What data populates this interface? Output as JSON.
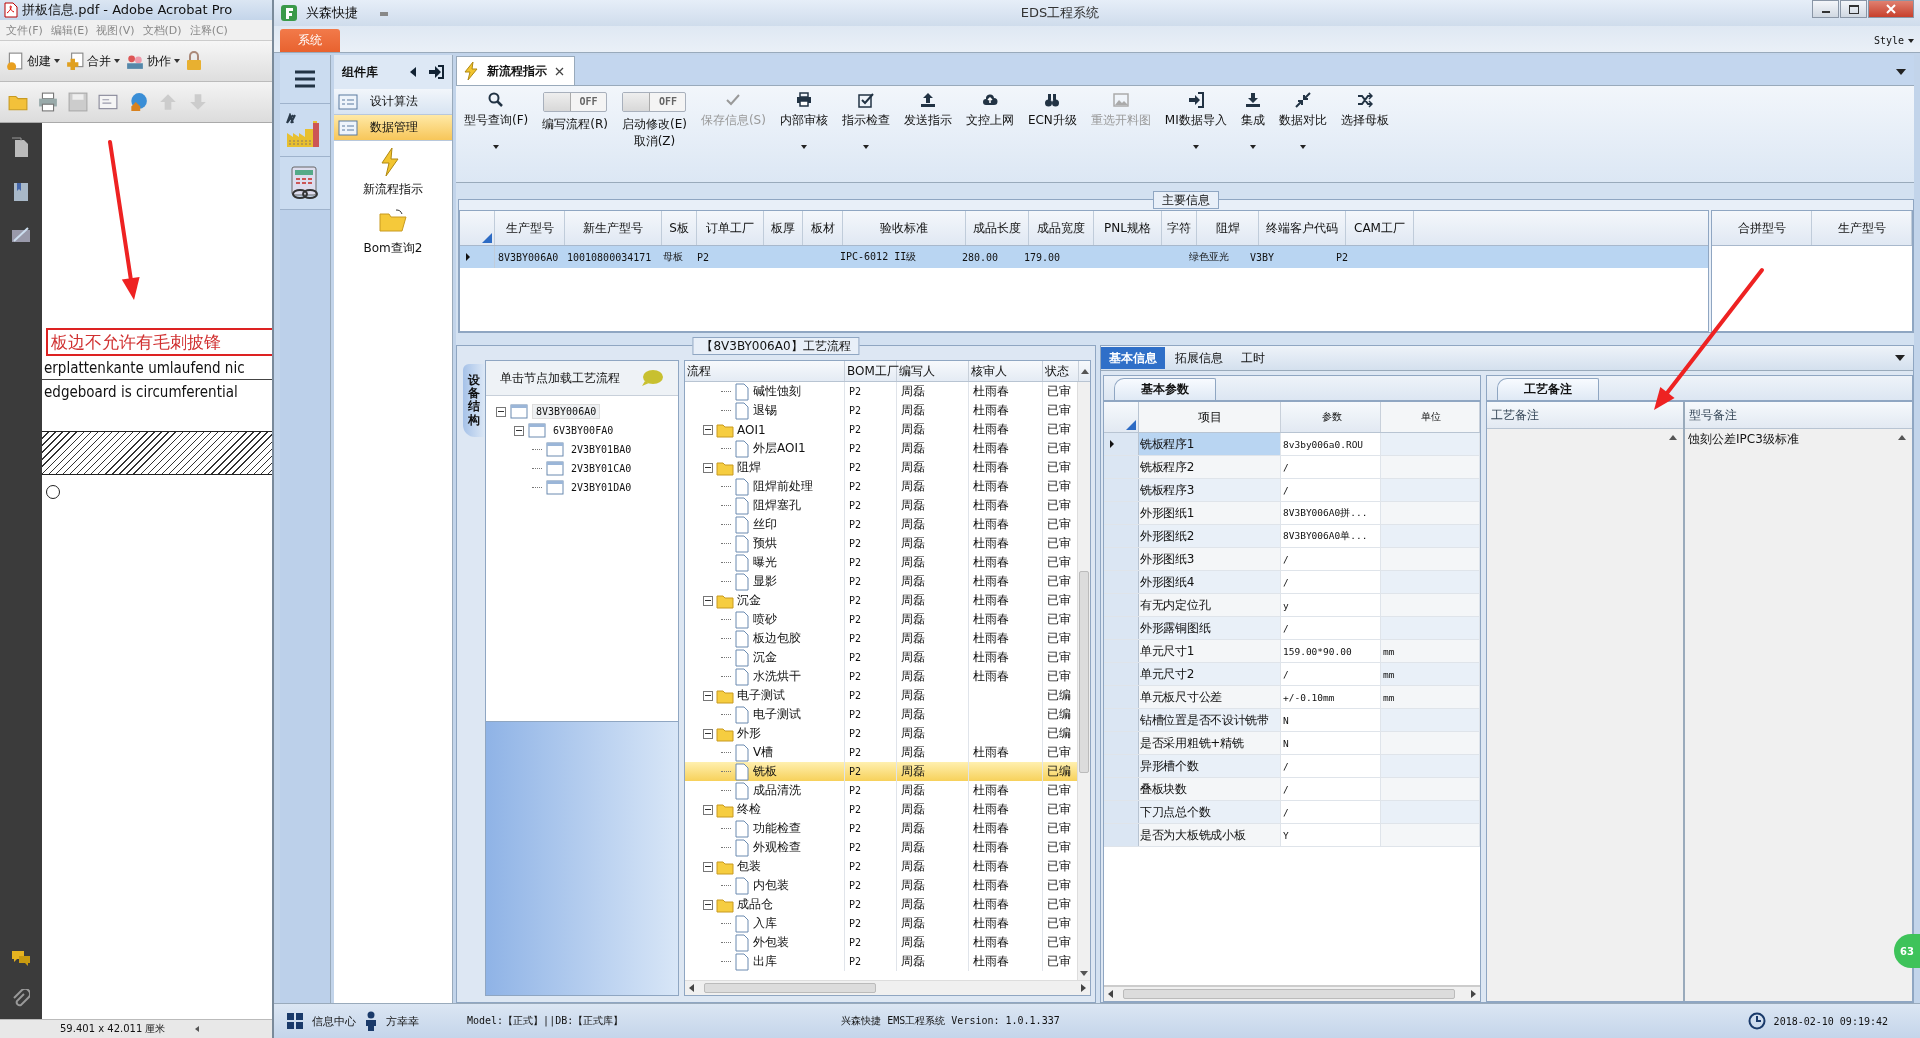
{
  "acrobat": {
    "title": "拼板信息.pdf - Adobe Acrobat Pro",
    "menu": [
      "文件(F)",
      "编辑(E)",
      "视图(V)",
      "文档(D)",
      "注释(C)"
    ],
    "tools": [
      {
        "label": "创建"
      },
      {
        "label": "合并"
      },
      {
        "label": "协作"
      }
    ],
    "document": {
      "note": "板边不允许有毛刺披锋",
      "lines": [
        "erplattenkante umlaufend nic",
        "edgeboard is circumferential"
      ]
    },
    "status": "59.401 x 42.011 厘米"
  },
  "eds": {
    "app_name": "兴森快捷",
    "title": "EDS工程系统",
    "menu_tab": "系统",
    "style_menu": "Style",
    "library": {
      "title": "组件库",
      "categories": [
        {
          "label": "设计算法",
          "selected": false
        },
        {
          "label": "数据管理",
          "selected": true
        }
      ],
      "items": [
        {
          "label": "新流程指示"
        },
        {
          "label": "Bom查询2"
        }
      ]
    },
    "doc_tab": {
      "label": "新流程指示"
    },
    "toolbar": [
      {
        "kind": "button",
        "label": "型号查询(F)",
        "disabled": false,
        "dropdown": true
      },
      {
        "kind": "toggle",
        "label": "编写流程(R)",
        "state_text": "OFF",
        "on": false
      },
      {
        "kind": "toggle",
        "label": "启动修改(E)\n取消(Z)",
        "state_text": "OFF",
        "on": false
      },
      {
        "kind": "button",
        "label": "保存信息(S)",
        "disabled": true,
        "dropdown": false
      },
      {
        "kind": "button",
        "label": "内部审核",
        "disabled": false,
        "dropdown": true
      },
      {
        "kind": "button",
        "label": "指示检查",
        "disabled": false,
        "dropdown": true
      },
      {
        "kind": "button",
        "label": "发送指示",
        "disabled": false,
        "dropdown": false
      },
      {
        "kind": "button",
        "label": "文控上网",
        "disabled": false,
        "dropdown": false
      },
      {
        "kind": "button",
        "label": "ECN升级",
        "disabled": false,
        "dropdown": false
      },
      {
        "kind": "button",
        "label": "重选开料图",
        "disabled": true,
        "dropdown": false
      },
      {
        "kind": "button",
        "label": "MI数据导入",
        "disabled": false,
        "dropdown": true
      },
      {
        "kind": "button",
        "label": "集成",
        "disabled": false,
        "dropdown": true
      },
      {
        "kind": "button",
        "label": "数据对比",
        "disabled": false,
        "dropdown": true
      },
      {
        "kind": "button",
        "label": "选择母板",
        "disabled": false,
        "dropdown": false
      }
    ],
    "main_info": {
      "title": "主要信息",
      "columns": [
        "生产型号",
        "新生产型号",
        "S板",
        "订单工厂",
        "板厚",
        "板材",
        "验收标准",
        "成品长度",
        "成品宽度",
        "PNL规格",
        "字符",
        "阻焊",
        "终端客户代码",
        "CAM工厂"
      ],
      "rows": [
        {
          "selected": true,
          "cells": [
            "8V3BY006A0",
            "10010800034171",
            "母板",
            "P2",
            null,
            null,
            "IPC-6012 II级",
            "280.00",
            "179.00",
            null,
            null,
            "绿色亚光",
            "V3BY",
            "P2"
          ]
        }
      ]
    },
    "merge_table": {
      "columns": [
        "合拼型号",
        "生产型号"
      ]
    },
    "flow": {
      "title": "【8V3BY006A0】工艺流程",
      "side_tab": "设备结构",
      "tree_hint": "单击节点加载工艺流程",
      "tree": [
        {
          "label": "8V3BY006A0",
          "selected": true,
          "expanded": true,
          "children": [
            {
              "label": "6V3BY00FA0",
              "selected": false,
              "expanded": true,
              "children": [
                {
                  "label": "2V3BY01BA0",
                  "selected": false
                },
                {
                  "label": "2V3BY01CA0",
                  "selected": false
                },
                {
                  "label": "2V3BY01DA0",
                  "selected": false
                }
              ]
            }
          ]
        }
      ],
      "columns": [
        "流程",
        "BOM工厂",
        "编写人",
        "核审人",
        "状态"
      ],
      "rows": [
        {
          "kind": "step",
          "name": "碱性蚀刻",
          "bom": "P2",
          "writer": "周磊",
          "reviewer": "杜雨春",
          "status": "已审",
          "selected": false
        },
        {
          "kind": "step",
          "name": "退锡",
          "bom": "P2",
          "writer": "周磊",
          "reviewer": "杜雨春",
          "status": "已审",
          "selected": false
        },
        {
          "kind": "folder",
          "name": "AOI1",
          "bom": "P2",
          "writer": "周磊",
          "reviewer": "杜雨春",
          "status": "已审",
          "selected": false,
          "expanded": true,
          "children": [
            {
              "kind": "step",
              "name": "外层AOI1",
              "bom": "P2",
              "writer": "周磊",
              "reviewer": "杜雨春",
              "status": "已审",
              "selected": false
            }
          ]
        },
        {
          "kind": "folder",
          "name": "阻焊",
          "bom": "P2",
          "writer": "周磊",
          "reviewer": "杜雨春",
          "status": "已审",
          "selected": false,
          "expanded": true,
          "children": [
            {
              "kind": "step",
              "name": "阻焊前处理",
              "bom": "P2",
              "writer": "周磊",
              "reviewer": "杜雨春",
              "status": "已审",
              "selected": false
            },
            {
              "kind": "step",
              "name": "阻焊塞孔",
              "bom": "P2",
              "writer": "周磊",
              "reviewer": "杜雨春",
              "status": "已审",
              "selected": false
            },
            {
              "kind": "step",
              "name": "丝印",
              "bom": "P2",
              "writer": "周磊",
              "reviewer": "杜雨春",
              "status": "已审",
              "selected": false
            },
            {
              "kind": "step",
              "name": "预烘",
              "bom": "P2",
              "writer": "周磊",
              "reviewer": "杜雨春",
              "status": "已审",
              "selected": false
            },
            {
              "kind": "step",
              "name": "曝光",
              "bom": "P2",
              "writer": "周磊",
              "reviewer": "杜雨春",
              "status": "已审",
              "selected": false
            },
            {
              "kind": "step",
              "name": "显影",
              "bom": "P2",
              "writer": "周磊",
              "reviewer": "杜雨春",
              "status": "已审",
              "selected": false
            }
          ]
        },
        {
          "kind": "folder",
          "name": "沉金",
          "bom": "P2",
          "writer": "周磊",
          "reviewer": "杜雨春",
          "status": "已审",
          "selected": false,
          "expanded": true,
          "children": [
            {
              "kind": "step",
              "name": "喷砂",
              "bom": "P2",
              "writer": "周磊",
              "reviewer": "杜雨春",
              "status": "已审",
              "selected": false
            },
            {
              "kind": "step",
              "name": "板边包胶",
              "bom": "P2",
              "writer": "周磊",
              "reviewer": "杜雨春",
              "status": "已审",
              "selected": false
            },
            {
              "kind": "step",
              "name": "沉金",
              "bom": "P2",
              "writer": "周磊",
              "reviewer": "杜雨春",
              "status": "已审",
              "selected": false
            },
            {
              "kind": "step",
              "name": "水洗烘干",
              "bom": "P2",
              "writer": "周磊",
              "reviewer": "杜雨春",
              "status": "已审",
              "selected": false
            }
          ]
        },
        {
          "kind": "folder",
          "name": "电子测试",
          "bom": "P2",
          "writer": "周磊",
          "status": "已编",
          "selected": false,
          "expanded": true,
          "children": [
            {
              "kind": "step",
              "name": "电子测试",
              "bom": "P2",
              "writer": "周磊",
              "status": "已编",
              "selected": false
            }
          ]
        },
        {
          "kind": "folder",
          "name": "外形",
          "bom": "P2",
          "writer": "周磊",
          "status": "已编",
          "selected": false,
          "expanded": true,
          "children": [
            {
              "kind": "step",
              "name": "V槽",
              "bom": "P2",
              "writer": "周磊",
              "reviewer": "杜雨春",
              "status": "已审",
              "selected": false
            },
            {
              "kind": "step",
              "name": "铣板",
              "bom": "P2",
              "writer": "周磊",
              "status": "已编",
              "selected": true
            },
            {
              "kind": "step",
              "name": "成品清洗",
              "bom": "P2",
              "writer": "周磊",
              "reviewer": "杜雨春",
              "status": "已审",
              "selected": false
            }
          ]
        },
        {
          "kind": "folder",
          "name": "终检",
          "bom": "P2",
          "writer": "周磊",
          "reviewer": "杜雨春",
          "status": "已审",
          "selected": false,
          "expanded": true,
          "children": [
            {
              "kind": "step",
              "name": "功能检查",
              "bom": "P2",
              "writer": "周磊",
              "reviewer": "杜雨春",
              "status": "已审",
              "selected": false
            },
            {
              "kind": "step",
              "name": "外观检查",
              "bom": "P2",
              "writer": "周磊",
              "reviewer": "杜雨春",
              "status": "已审",
              "selected": false
            }
          ]
        },
        {
          "kind": "folder",
          "name": "包装",
          "bom": "P2",
          "writer": "周磊",
          "reviewer": "杜雨春",
          "status": "已审",
          "selected": false,
          "expanded": true,
          "children": [
            {
              "kind": "step",
              "name": "内包装",
              "bom": "P2",
              "writer": "周磊",
              "reviewer": "杜雨春",
              "status": "已审",
              "selected": false
            }
          ]
        },
        {
          "kind": "folder",
          "name": "成品仓",
          "bom": "P2",
          "writer": "周磊",
          "reviewer": "杜雨春",
          "status": "已审",
          "selected": false,
          "expanded": true,
          "children": [
            {
              "kind": "step",
              "name": "入库",
              "bom": "P2",
              "writer": "周磊",
              "reviewer": "杜雨春",
              "status": "已审",
              "selected": false
            },
            {
              "kind": "step",
              "name": "外包装",
              "bom": "P2",
              "writer": "周磊",
              "reviewer": "杜雨春",
              "status": "已审",
              "selected": false
            },
            {
              "kind": "step",
              "name": "出库",
              "bom": "P2",
              "writer": "周磊",
              "reviewer": "杜雨春",
              "status": "已审",
              "selected": false
            }
          ]
        }
      ]
    },
    "detail": {
      "tabs": [
        {
          "label": "基本信息",
          "selected": true
        },
        {
          "label": "拓展信息",
          "selected": false
        },
        {
          "label": "工时",
          "selected": false
        }
      ],
      "params": {
        "tab": "基本参数",
        "columns": [
          "项目",
          "参数",
          "单位"
        ],
        "rows": [
          {
            "item": "铣板程序1",
            "value": "8v3by006a0.ROU",
            "selected": true
          },
          {
            "item": "铣板程序2",
            "value": "/",
            "selected": false
          },
          {
            "item": "铣板程序3",
            "value": "/",
            "selected": false
          },
          {
            "item": "外形图纸1",
            "value": "8V3BY006A0拼...",
            "selected": false
          },
          {
            "item": "外形图纸2",
            "value": "8V3BY006A0单...",
            "selected": false
          },
          {
            "item": "外形图纸3",
            "value": "/",
            "selected": false
          },
          {
            "item": "外形图纸4",
            "value": "/",
            "selected": false
          },
          {
            "item": "有无内定位孔",
            "value": "y",
            "selected": false
          },
          {
            "item": "外形露铜图纸",
            "value": "/",
            "selected": false
          },
          {
            "item": "单元尺寸1",
            "value": "159.00*90.00",
            "unit": "mm",
            "selected": false
          },
          {
            "item": "单元尺寸2",
            "value": "/",
            "unit": "mm",
            "selected": false
          },
          {
            "item": "单元板尺寸公差",
            "value": "+/-0.10mm",
            "unit": "mm",
            "selected": false
          },
          {
            "item": "钻槽位置是否不设计铣带",
            "value": "N",
            "selected": false
          },
          {
            "item": "是否采用粗铣+精铣",
            "value": "N",
            "selected": false
          },
          {
            "item": "异形槽个数",
            "value": "/",
            "selected": false
          },
          {
            "item": "叠板块数",
            "value": "/",
            "selected": false
          },
          {
            "item": "下刀点总个数",
            "value": "/",
            "selected": false
          },
          {
            "item": "是否为大板铣成小板",
            "value": "Y",
            "selected": false
          }
        ]
      },
      "remarks": {
        "tab": "工艺备注",
        "columns": [
          {
            "title": "工艺备注"
          },
          {
            "title": "型号备注",
            "text": "蚀刻公差IPC3级标准"
          }
        ]
      }
    },
    "badge": "63",
    "status_bar": {
      "info": "信息中心",
      "user": "方幸幸",
      "env": "Model:【正式】||DB:【正式库】",
      "product": "兴森快捷 EMS工程系统 Version: 1.0.1.337",
      "time": "2018-02-10 09:19:42"
    }
  }
}
